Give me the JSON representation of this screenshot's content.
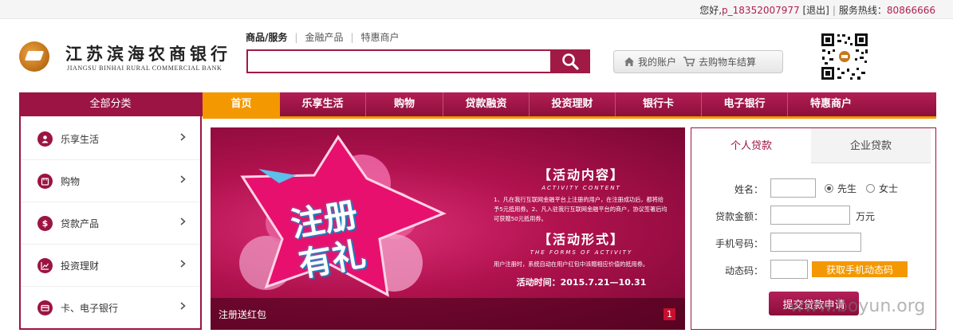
{
  "topbar": {
    "greeting": "您好,",
    "username": "p_18352007977",
    "logout": "[退出]",
    "hotline_label": "服务热线：",
    "hotline_number": "80866666"
  },
  "logo": {
    "name_cn": "江苏滨海农商银行",
    "name_en": "JIANGSU BINHAI RURAL COMMERCIAL BANK"
  },
  "search": {
    "tabs": [
      "商品/服务",
      "金融产品",
      "特惠商户"
    ],
    "active_tab": 0,
    "placeholder": "",
    "value": "",
    "button_icon": "search-icon"
  },
  "account": {
    "my_account": "我的账户",
    "cart": "去购物车结算"
  },
  "nav": {
    "all_categories": "全部分类",
    "items": [
      "首页",
      "乐享生活",
      "购物",
      "贷款融资",
      "投资理财",
      "银行卡",
      "电子银行",
      "特惠商户"
    ],
    "active": 0
  },
  "categories": [
    {
      "label": "乐享生活",
      "icon": "user-icon"
    },
    {
      "label": "购物",
      "icon": "shopping-icon"
    },
    {
      "label": "贷款产品",
      "icon": "dollar-icon"
    },
    {
      "label": "投资理财",
      "icon": "chart-icon"
    },
    {
      "label": "卡、电子银行",
      "icon": "card-icon"
    }
  ],
  "banner": {
    "big_text_1": "注册",
    "big_text_2": "有礼",
    "section1_title": "【活动内容】",
    "section1_en": "ACTIVITY CONTENT",
    "section1_body": "1、凡在我行互联网金融平台上注册的用户，在注册成功后，都将给予5元抵用券。2、凡入驻我行互联网金融平台的商户，协议签署后均可获赠50元抵用券。",
    "section2_title": "【活动形式】",
    "section2_en": "THE FORMS OF ACTIVITY",
    "section2_body": "用户注册时，系统自动在用户红包中派赠相应价值的抵用券。",
    "time": "活动时间：2015.7.21—10.31",
    "caption": "注册送红包",
    "page": "1"
  },
  "loan": {
    "tabs": [
      "个人贷款",
      "企业贷款"
    ],
    "active_tab": 0,
    "name_label": "姓名：",
    "gender_male": "先生",
    "gender_female": "女士",
    "gender_selected": "先生",
    "amount_label": "贷款金额：",
    "amount_unit": "万元",
    "phone_label": "手机号码：",
    "code_label": "动态码：",
    "code_button": "获取手机动态码",
    "submit": "提交贷款申请"
  },
  "watermark": "www.boyun.org",
  "colors": {
    "brand": "#9b1443",
    "accent": "#f39800"
  }
}
